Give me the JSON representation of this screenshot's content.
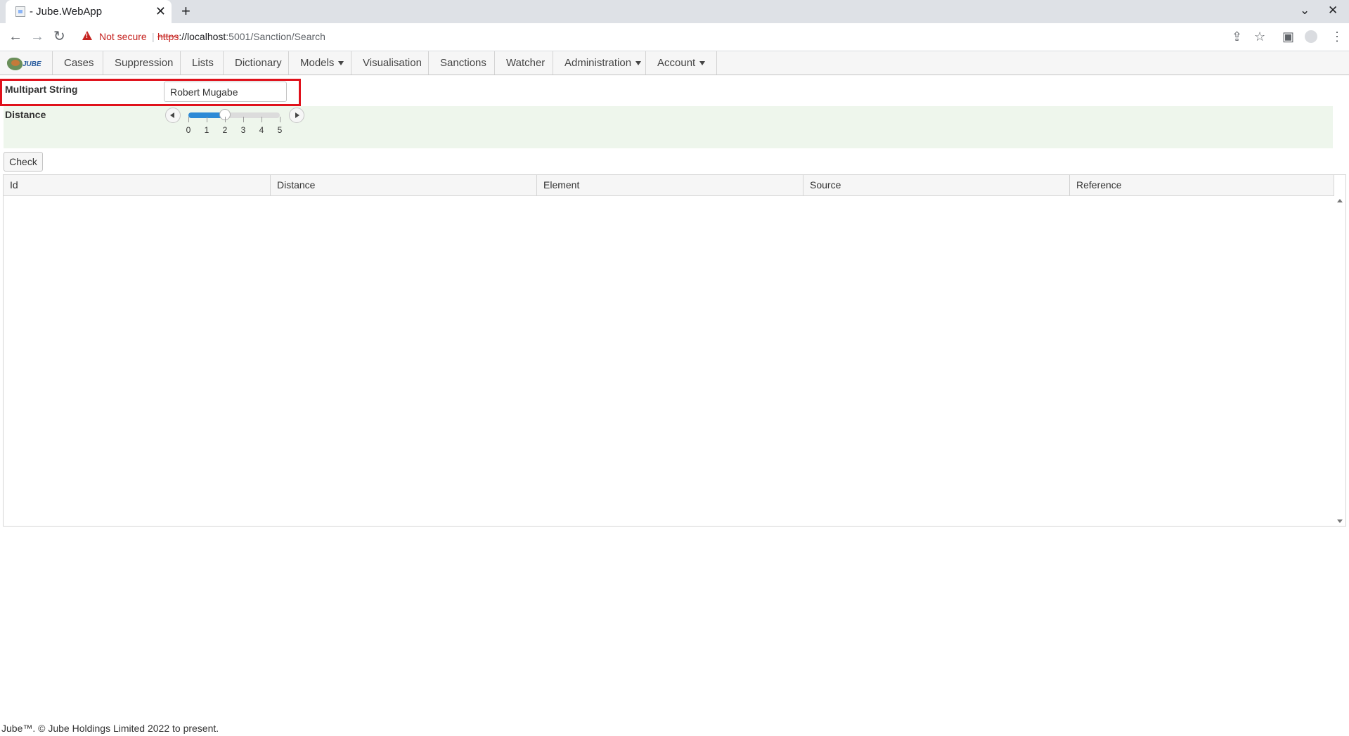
{
  "browser": {
    "tab_title": "- Jube.WebApp",
    "tab_close": "✕",
    "new_tab": "+",
    "security_label": "Not secure",
    "url_scheme": "https",
    "url_host": "://localhost",
    "url_rest": ":5001/Sanction/Search"
  },
  "nav": {
    "logo_text": "JUBE",
    "items": [
      {
        "label": "Cases"
      },
      {
        "label": "Suppression"
      },
      {
        "label": "Lists"
      },
      {
        "label": "Dictionary"
      },
      {
        "label": "Models"
      },
      {
        "label": "Visualisation"
      },
      {
        "label": "Sanctions"
      },
      {
        "label": "Watcher"
      },
      {
        "label": "Administration"
      },
      {
        "label": "Account"
      }
    ]
  },
  "form": {
    "multipart_label": "Multipart String",
    "multipart_value": "Robert Mugabe",
    "distance_label": "Distance",
    "distance_value": 2,
    "distance_min": 0,
    "distance_max": 5,
    "tick_labels": [
      "0",
      "1",
      "2",
      "3",
      "4",
      "5"
    ],
    "check_label": "Check"
  },
  "grid": {
    "columns": [
      "Id",
      "Distance",
      "Element",
      "Source",
      "Reference"
    ],
    "rows": []
  },
  "footer": {
    "text": "Jube™. © Jube Holdings Limited 2022 to present."
  }
}
